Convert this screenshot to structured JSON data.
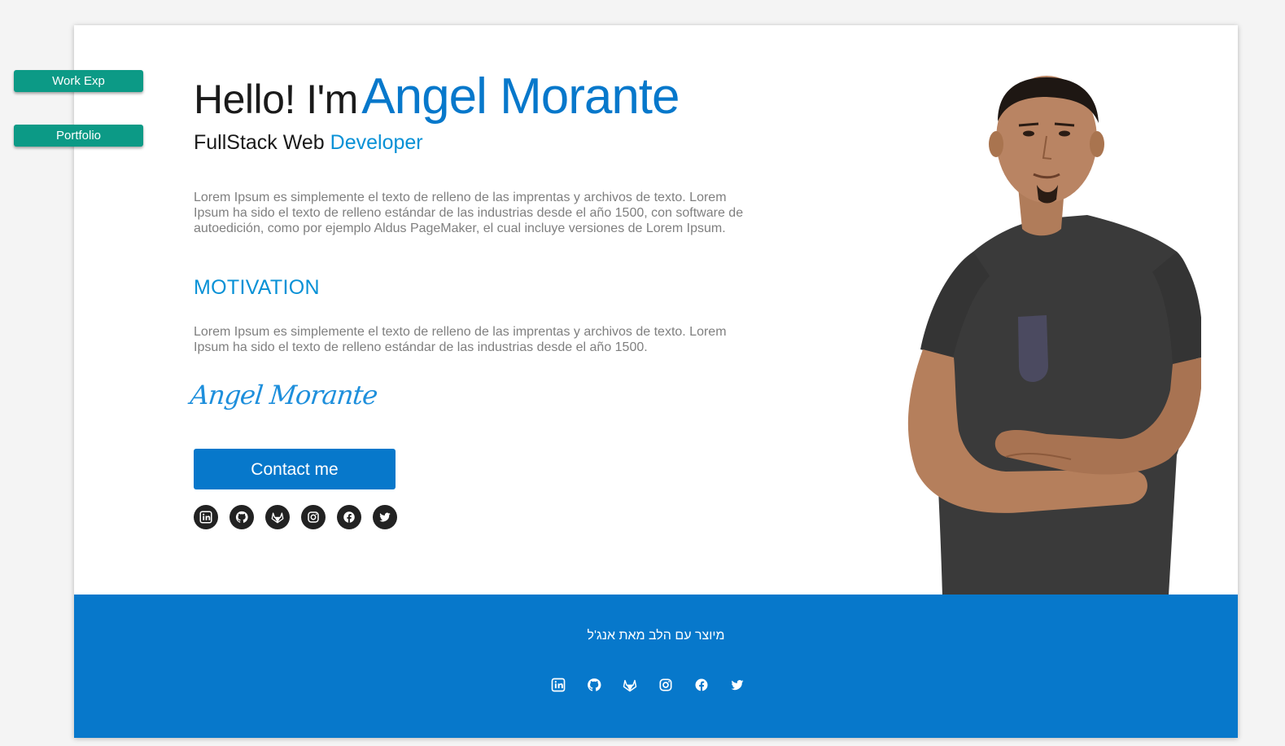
{
  "side_nav": {
    "items": [
      {
        "label": "Work Exp"
      },
      {
        "label": "Portfolio"
      }
    ]
  },
  "hero": {
    "greeting": "Hello! I'm",
    "name": "Angel Morante",
    "role_prefix": "FullStack Web",
    "role_accent": "Developer",
    "intro": "Lorem Ipsum es simplemente el texto de relleno de las imprentas y archivos de texto. Lorem Ipsum ha sido el texto de relleno estándar de las industrias desde el año 1500, con software de autoedición, como por ejemplo Aldus PageMaker, el cual incluye versiones de Lorem Ipsum.",
    "motivation_heading": "MOTIVATION",
    "motivation_text": "Lorem Ipsum es simplemente el texto de relleno de las imprentas y archivos de texto. Lorem Ipsum ha sido el texto de relleno estándar de las industrias desde el año 1500.",
    "signature": "Angel Morante",
    "contact_label": "Contact me"
  },
  "social": [
    "linkedin-icon",
    "github-icon",
    "gitlab-icon",
    "instagram-icon",
    "facebook-icon",
    "twitter-icon"
  ],
  "footer": {
    "text": "מיוצר עם הלב מאת אנג'ל"
  },
  "colors": {
    "accent": "#0778cb",
    "accent_light": "#0891d6",
    "nav_green": "#0c9a86",
    "body_text": "#7f7f7f"
  }
}
